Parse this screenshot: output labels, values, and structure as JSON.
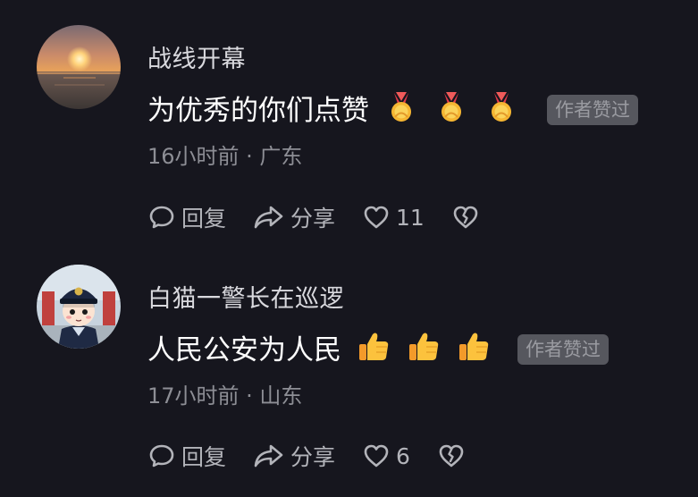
{
  "comments": [
    {
      "username": "战线开幕",
      "text": "为优秀的你们点赞",
      "emojis": [
        "medal",
        "medal",
        "medal"
      ],
      "badge": "作者赞过",
      "meta": "16小时前 · 广东",
      "reply_label": "回复",
      "share_label": "分享",
      "likes": "11",
      "avatar_icon": "sunset-avatar"
    },
    {
      "username": "白猫一警长在巡逻",
      "text": "人民公安为人民",
      "emojis": [
        "thumbs-up",
        "thumbs-up",
        "thumbs-up"
      ],
      "badge": "作者赞过",
      "meta": "17小时前 · 山东",
      "reply_label": "回复",
      "share_label": "分享",
      "likes": "6",
      "avatar_icon": "police-cartoon-avatar"
    }
  ],
  "colors": {
    "background": "#16161e",
    "username": "#d9d9de",
    "meta": "#8d8e95",
    "badge_bg": "#56575e",
    "badge_text": "#9a9ba1",
    "action": "#b3b4ba"
  }
}
